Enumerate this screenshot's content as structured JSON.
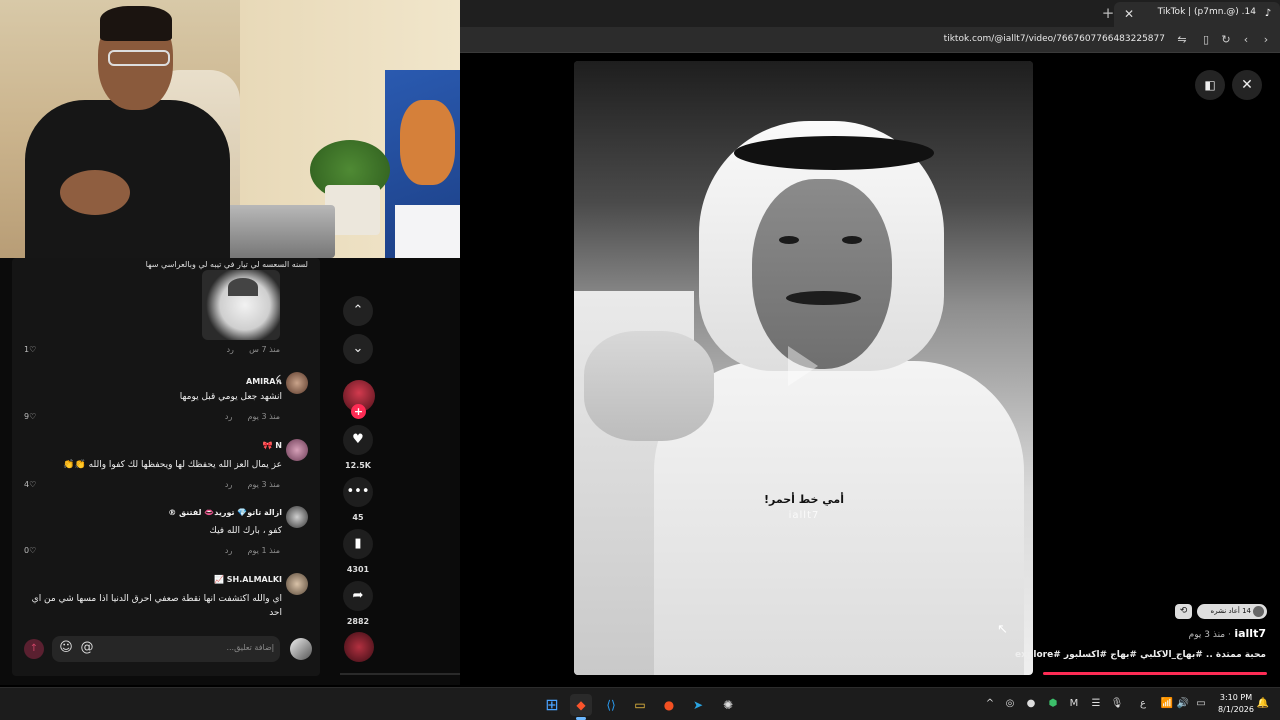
{
  "browser": {
    "tab_title": "TikTok | (p7mn.@) .14",
    "url": "tiktok.com/@iallt7/video/7667607766483225877"
  },
  "comments": {
    "cut_text": "لسنه السعسه لي تيار في تيبه لي وبالعراسي سها",
    "items": [
      {
        "meta": "منذ 7 س",
        "reply": "رد",
        "likes": "1"
      },
      {
        "name": "AMIRAꫝ",
        "text": "انشهد جعل يومي قبل يومها",
        "meta": "منذ 3 يوم",
        "reply": "رد",
        "likes": "9"
      },
      {
        "name": "N 🎀",
        "text": "عز يمال العز الله يحفظك لها ويحفظها لك كفوا والله 👏👏",
        "meta": "منذ 3 يوم",
        "reply": "رد",
        "likes": "4"
      },
      {
        "name": "ازالة تاتو💎 توريد👄 لفتنق ®",
        "text": "كفو ، بارك الله فيك",
        "meta": "منذ 1 يوم",
        "reply": "رد",
        "likes": "0"
      },
      {
        "name": "SH.ALMALKI 📈",
        "text": "اي والله اكتشفت انها نقطة صعفي احرق الدنيا اذا مسها شي من اي احد",
        "meta": "",
        "reply": "",
        "likes": ""
      }
    ],
    "placeholder": "إضافة تعليق..."
  },
  "rail": {
    "likes": "12.5K",
    "comments": "45",
    "saves": "4301",
    "shares": "2882"
  },
  "video": {
    "caption": "أمي خط أحمر!",
    "watermark": "iallt7"
  },
  "info": {
    "repost_text": "14 أعاد نشره",
    "author": "iallt7",
    "time": "· منذ 3 يوم",
    "description": "محبة ممتدة .. #بهاج_الاكلبي #بهاج #اكسلبور #explore"
  },
  "taskbar": {
    "time": "3:10 PM",
    "date": "8/1/2026",
    "lang": "ع"
  },
  "icons": {
    "chevron_up": "chevron-up-icon",
    "chevron_down": "chevron-down-icon",
    "heart": "heart-icon",
    "comment": "comment-icon",
    "bookmark": "bookmark-icon",
    "share": "share-icon"
  },
  "colors": {
    "tiktok_red": "#fe2c55",
    "background": "#000000"
  }
}
